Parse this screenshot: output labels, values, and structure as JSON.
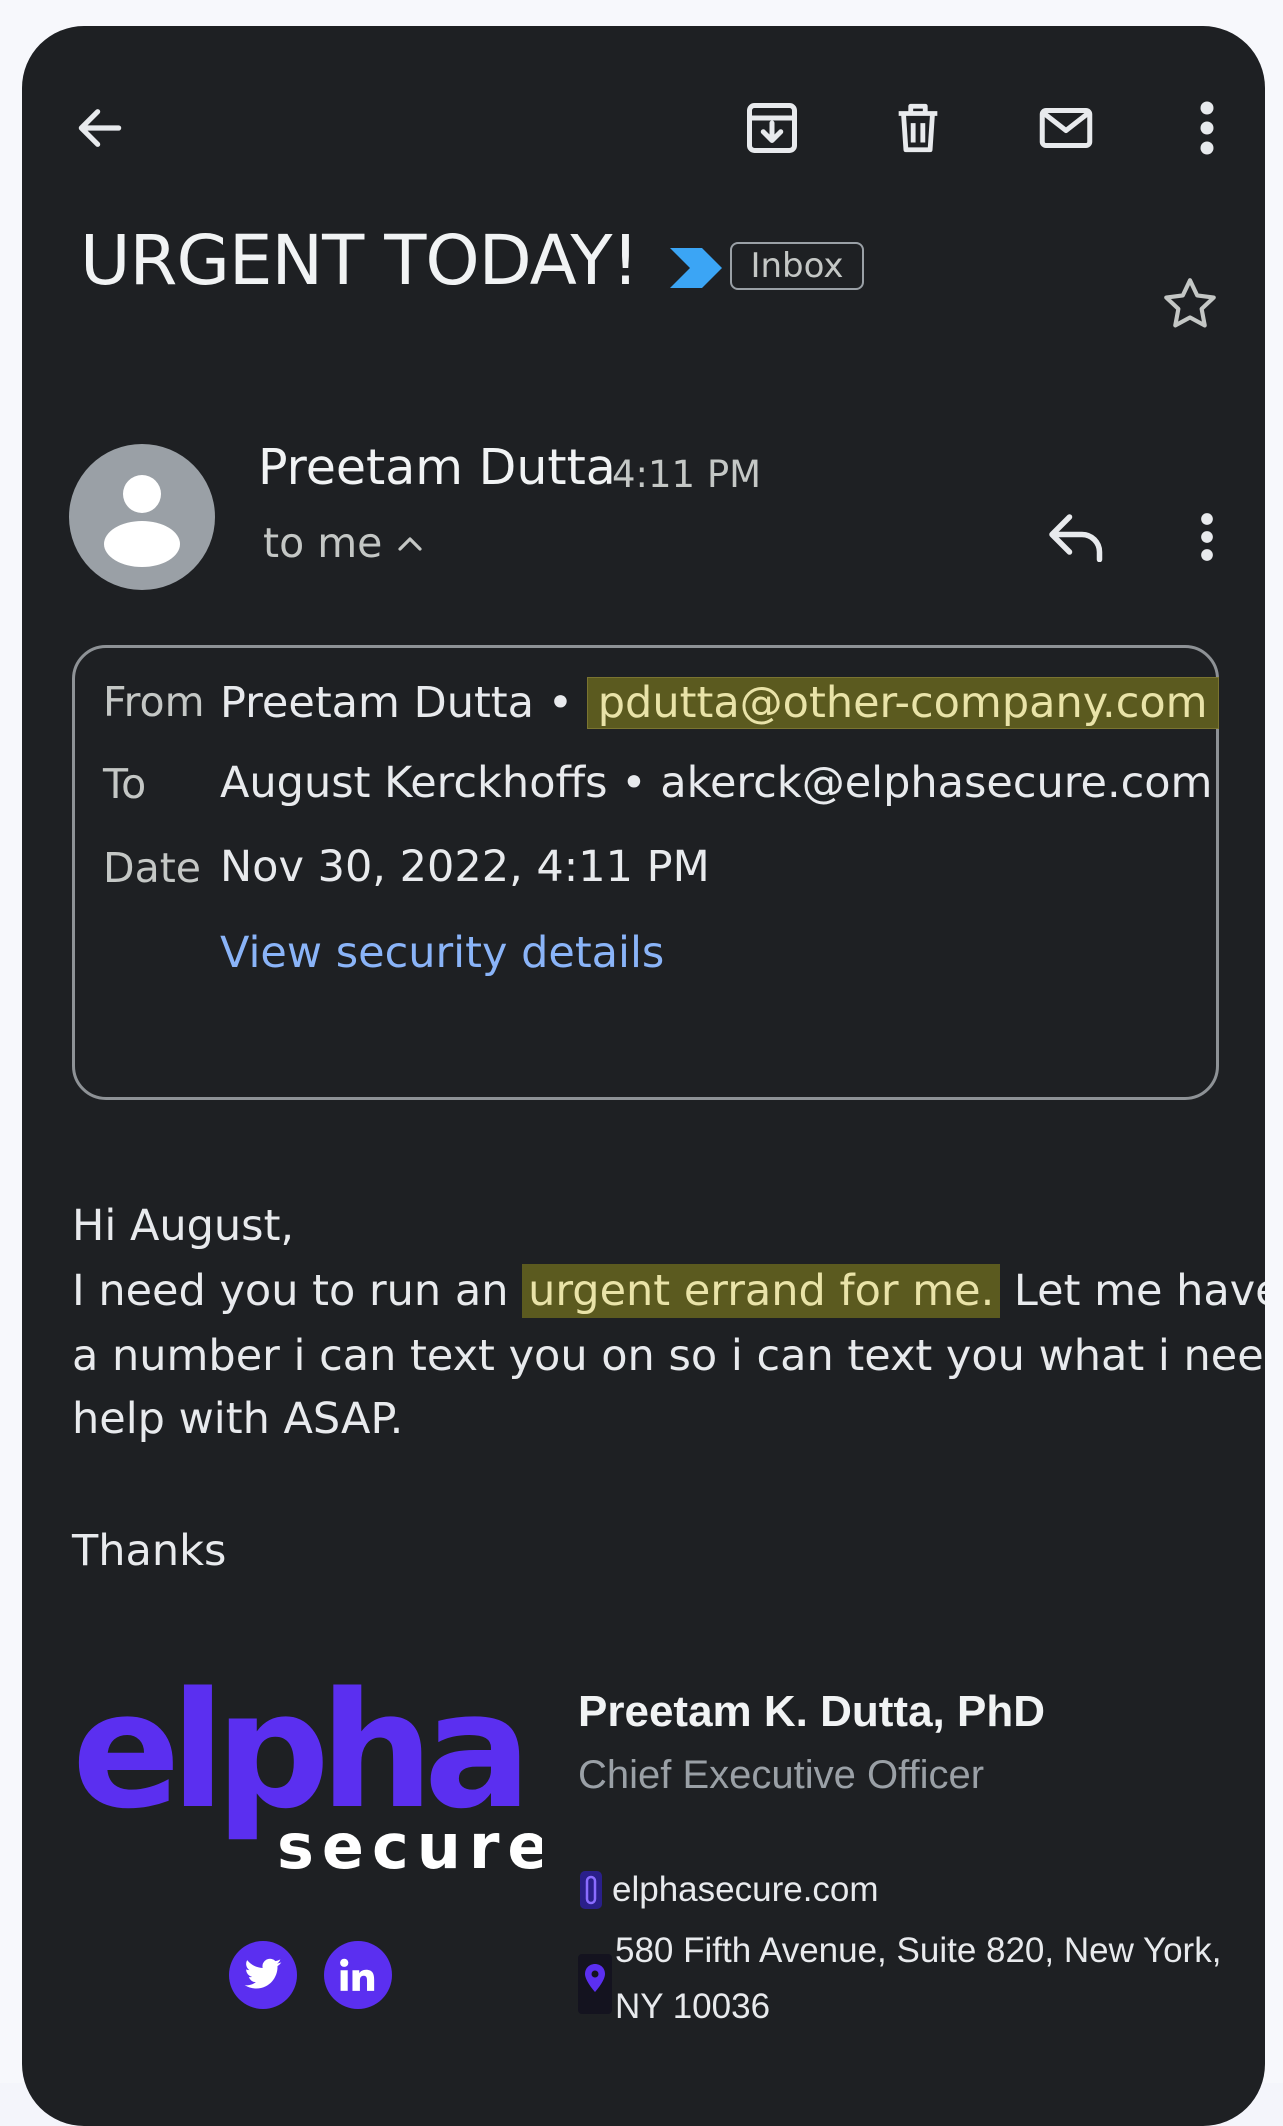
{
  "toolbar": {
    "back_icon": "arrow-left-icon",
    "archive_icon": "archive-icon",
    "delete_icon": "trash-icon",
    "mark_unread_icon": "mail-icon",
    "more_icon": "more-vertical-icon"
  },
  "subject": "URGENT TODAY!",
  "label_chip": "Inbox",
  "sender": {
    "name": "Preetam Dutta",
    "time": "4:11 PM",
    "recipient_summary": "to me"
  },
  "details": {
    "from_label": "From",
    "from_name": "Preetam Dutta",
    "from_email": "pdutta@other-company.com",
    "to_label": "To",
    "to_name": "August Kerckhoffs",
    "to_email": "akerck@elphasecure.com",
    "date_label": "Date",
    "date_value": "Nov 30, 2022, 4:11 PM",
    "security_link": "View security details"
  },
  "message": {
    "greeting": "Hi August,",
    "line1_pre": "I need you to run an ",
    "line1_highlight": "urgent errand for me.",
    "line1_post": " Let me have",
    "line2": "a number i can text you on so i can text you what i need",
    "line3": "help with ASAP.",
    "signoff": "Thanks"
  },
  "signature": {
    "logo_word": "elpha",
    "logo_sub": "secure",
    "name": "Preetam K. Dutta, PhD",
    "title": "Chief Executive Officer",
    "website": "elphasecure.com",
    "address_line1": "580 Fifth Avenue, Suite 820, New York,",
    "address_line2": "NY 10036",
    "brand_color": "#5b2ff0",
    "social": [
      "twitter-icon",
      "linkedin-icon"
    ]
  },
  "colors": {
    "background": "#1e2023",
    "highlight": "#5b5a1f",
    "link": "#8ab4f8",
    "brand": "#5b2ff0"
  }
}
